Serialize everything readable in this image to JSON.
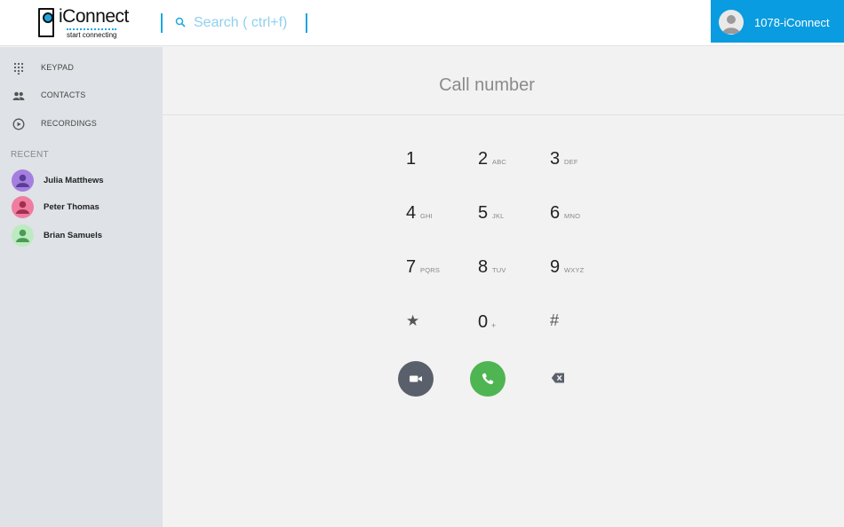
{
  "header": {
    "logo_word": "iConnect",
    "logo_tag": "start connecting",
    "search_placeholder": "Search ( ctrl+f)",
    "account_name": "1078-iConnect"
  },
  "sidebar": {
    "nav": [
      {
        "label": "KEYPAD",
        "icon": "keypad-icon"
      },
      {
        "label": "CONTACTS",
        "icon": "contacts-icon"
      },
      {
        "label": "RECORDINGS",
        "icon": "recordings-icon"
      }
    ],
    "recent_heading": "RECENT",
    "recent": [
      {
        "name": "Julia Matthews",
        "color": "#a47fe0"
      },
      {
        "name": "Peter Thomas",
        "color": "#f07ca0"
      },
      {
        "name": "Brian Samuels",
        "color": "#9cdba2"
      }
    ]
  },
  "main": {
    "title": "Call number",
    "keys": [
      {
        "digit": "1",
        "letters": ""
      },
      {
        "digit": "2",
        "letters": "ABC"
      },
      {
        "digit": "3",
        "letters": "DEF"
      },
      {
        "digit": "4",
        "letters": "GHI"
      },
      {
        "digit": "5",
        "letters": "JKL"
      },
      {
        "digit": "6",
        "letters": "MNO"
      },
      {
        "digit": "7",
        "letters": "PQRS"
      },
      {
        "digit": "8",
        "letters": "TUV"
      },
      {
        "digit": "9",
        "letters": "WXYZ"
      },
      {
        "digit": "★",
        "letters": ""
      },
      {
        "digit": "0",
        "letters": "+"
      },
      {
        "digit": "#",
        "letters": ""
      }
    ]
  },
  "colors": {
    "accent": "#0a9ce0",
    "call_green": "#4fb552",
    "video_gray": "#5a606b",
    "sidebar_bg": "#dfe2e6"
  }
}
